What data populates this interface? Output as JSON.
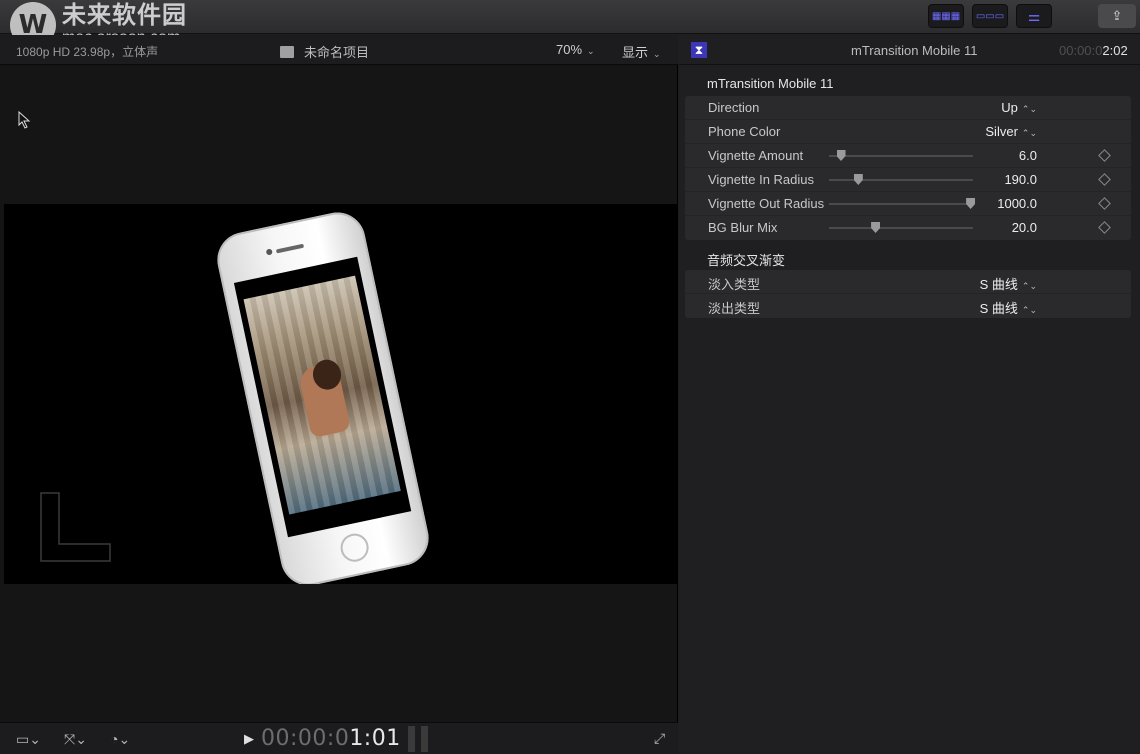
{
  "watermark": {
    "logo_letter": "W",
    "title": "未来软件园",
    "url": "mac.orsoon.com"
  },
  "toolbar": {
    "buttons": [
      {
        "name": "browser-grid-button",
        "glyph": "▦▦▦"
      },
      {
        "name": "timeline-button",
        "glyph": "▭▭▭"
      },
      {
        "name": "inspector-button",
        "glyph": "⚌"
      }
    ],
    "share_glyph": "⇪"
  },
  "viewer": {
    "format": "1080p HD 23.98p，立体声",
    "project_name": "未命名项目",
    "zoom": "70%",
    "display_menu": "显示",
    "timecode_dim": "00:00:0",
    "timecode_main": "1:01",
    "play_glyph": "▶",
    "expand_glyph": "⤢",
    "footer_icons": [
      "▭⌄",
      "⤧⌄",
      "◔⌄"
    ]
  },
  "inspector": {
    "icon_glyph": "⧗",
    "title": "mTransition Mobile 11",
    "timecode_dim": "00:00:0",
    "timecode_main": "2:02",
    "effect_section": {
      "title": "mTransition Mobile 11",
      "params": [
        {
          "label": "Direction",
          "value": "Up",
          "kind": "popup"
        },
        {
          "label": "Phone Color",
          "value": "Silver",
          "kind": "popup"
        },
        {
          "label": "Vignette Amount",
          "value": "6.0",
          "kind": "slider",
          "fraction": 0.08
        },
        {
          "label": "Vignette In Radius",
          "value": "190.0",
          "kind": "slider",
          "fraction": 0.2
        },
        {
          "label": "Vignette Out Radius",
          "value": "1000.0",
          "kind": "slider",
          "fraction": 0.98
        },
        {
          "label": "BG Blur Mix",
          "value": "20.0",
          "kind": "slider",
          "fraction": 0.32
        }
      ]
    },
    "audio_section": {
      "title": "音频交叉渐变",
      "params": [
        {
          "label": "淡入类型",
          "value": "S 曲线",
          "kind": "popup"
        },
        {
          "label": "淡出类型",
          "value": "S 曲线",
          "kind": "popup"
        }
      ]
    }
  }
}
